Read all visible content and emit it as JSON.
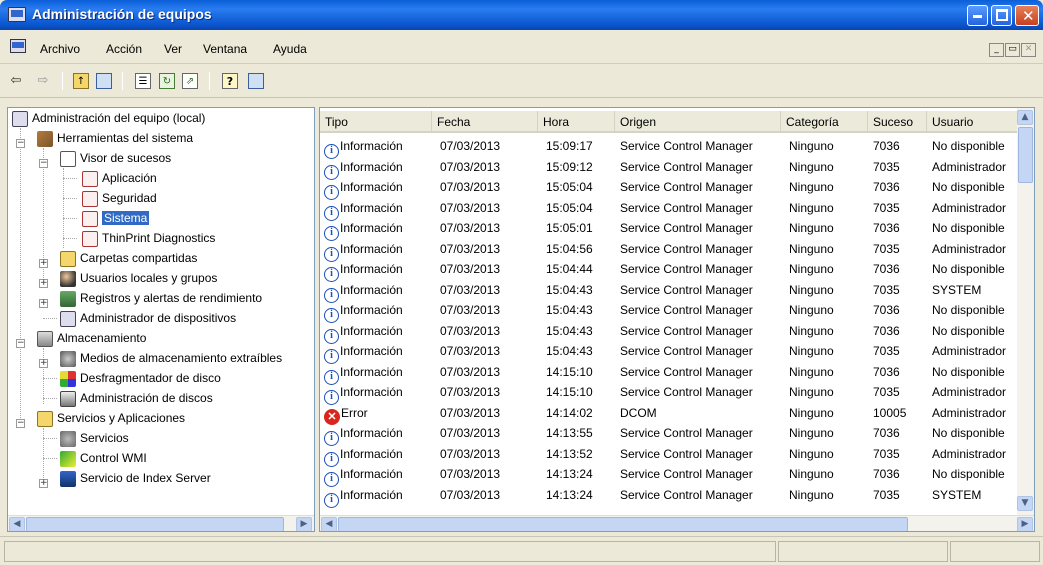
{
  "window": {
    "title": "Administración de equipos"
  },
  "menu": {
    "items": [
      "Archivo",
      "Acción",
      "Ver",
      "Ventana",
      "Ayuda"
    ]
  },
  "toolbar": {
    "icons": [
      "back-arrow-icon",
      "forward-arrow-icon",
      "up-folder-icon",
      "show-tree-icon",
      "properties-icon",
      "refresh-icon",
      "export-icon",
      "help-icon",
      "console-icon"
    ]
  },
  "tree": {
    "root": "Administración del equipo (local)",
    "items": [
      {
        "label": "Herramientas del sistema"
      },
      {
        "label": "Visor de sucesos"
      },
      {
        "label": "Aplicación"
      },
      {
        "label": "Seguridad"
      },
      {
        "label": "Sistema"
      },
      {
        "label": "ThinPrint Diagnostics"
      },
      {
        "label": "Carpetas compartidas"
      },
      {
        "label": "Usuarios locales y grupos"
      },
      {
        "label": "Registros y alertas de rendimiento"
      },
      {
        "label": "Administrador de dispositivos"
      },
      {
        "label": "Almacenamiento"
      },
      {
        "label": "Medios de almacenamiento extraíbles"
      },
      {
        "label": "Desfragmentador de disco"
      },
      {
        "label": "Administración de discos"
      },
      {
        "label": "Servicios y Aplicaciones"
      },
      {
        "label": "Servicios"
      },
      {
        "label": "Control WMI"
      },
      {
        "label": "Servicio de Index Server"
      }
    ]
  },
  "table": {
    "columns": [
      "Tipo",
      "Fecha",
      "Hora",
      "Origen",
      "Categoría",
      "Suceso",
      "Usuario"
    ],
    "rows": [
      [
        "Información",
        "07/03/2013",
        "15:09:17",
        "Service Control Manager",
        "Ninguno",
        "7036",
        "No disponible"
      ],
      [
        "Información",
        "07/03/2013",
        "15:09:12",
        "Service Control Manager",
        "Ninguno",
        "7035",
        "Administrador"
      ],
      [
        "Información",
        "07/03/2013",
        "15:05:04",
        "Service Control Manager",
        "Ninguno",
        "7036",
        "No disponible"
      ],
      [
        "Información",
        "07/03/2013",
        "15:05:04",
        "Service Control Manager",
        "Ninguno",
        "7035",
        "Administrador"
      ],
      [
        "Información",
        "07/03/2013",
        "15:05:01",
        "Service Control Manager",
        "Ninguno",
        "7036",
        "No disponible"
      ],
      [
        "Información",
        "07/03/2013",
        "15:04:56",
        "Service Control Manager",
        "Ninguno",
        "7035",
        "Administrador"
      ],
      [
        "Información",
        "07/03/2013",
        "15:04:44",
        "Service Control Manager",
        "Ninguno",
        "7036",
        "No disponible"
      ],
      [
        "Información",
        "07/03/2013",
        "15:04:43",
        "Service Control Manager",
        "Ninguno",
        "7035",
        "SYSTEM"
      ],
      [
        "Información",
        "07/03/2013",
        "15:04:43",
        "Service Control Manager",
        "Ninguno",
        "7036",
        "No disponible"
      ],
      [
        "Información",
        "07/03/2013",
        "15:04:43",
        "Service Control Manager",
        "Ninguno",
        "7036",
        "No disponible"
      ],
      [
        "Información",
        "07/03/2013",
        "15:04:43",
        "Service Control Manager",
        "Ninguno",
        "7035",
        "Administrador"
      ],
      [
        "Información",
        "07/03/2013",
        "14:15:10",
        "Service Control Manager",
        "Ninguno",
        "7036",
        "No disponible"
      ],
      [
        "Información",
        "07/03/2013",
        "14:15:10",
        "Service Control Manager",
        "Ninguno",
        "7035",
        "Administrador"
      ],
      [
        "Error",
        "07/03/2013",
        "14:14:02",
        "DCOM",
        "Ninguno",
        "10005",
        "Administrador"
      ],
      [
        "Información",
        "07/03/2013",
        "14:13:55",
        "Service Control Manager",
        "Ninguno",
        "7036",
        "No disponible"
      ],
      [
        "Información",
        "07/03/2013",
        "14:13:52",
        "Service Control Manager",
        "Ninguno",
        "7035",
        "Administrador"
      ],
      [
        "Información",
        "07/03/2013",
        "14:13:24",
        "Service Control Manager",
        "Ninguno",
        "7036",
        "No disponible"
      ],
      [
        "Información",
        "07/03/2013",
        "14:13:24",
        "Service Control Manager",
        "Ninguno",
        "7035",
        "SYSTEM"
      ]
    ]
  }
}
